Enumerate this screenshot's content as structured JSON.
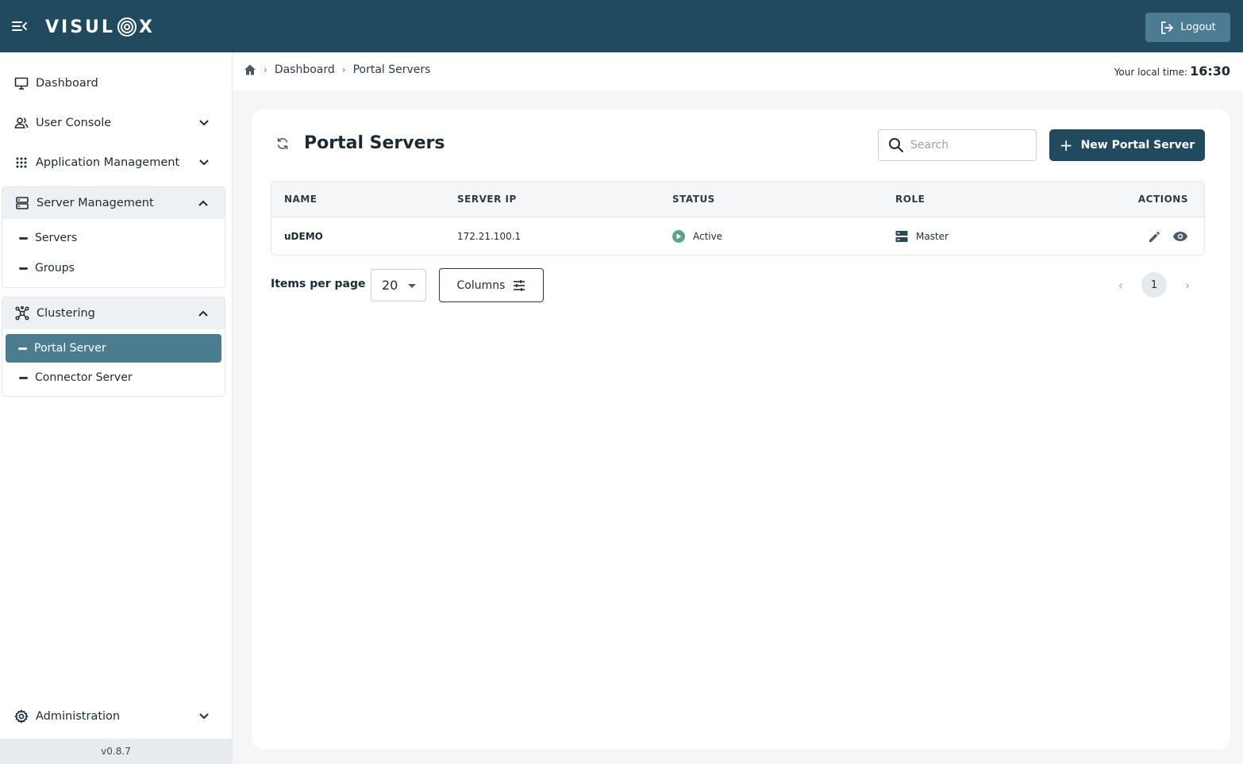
{
  "app": {
    "logo_text_left": "VISUL",
    "logo_text_right": "X"
  },
  "topbar": {
    "logout_label": "Logout"
  },
  "sidebar": {
    "dashboard": "Dashboard",
    "user_console": "User Console",
    "application_management": "Application Management",
    "server_management": {
      "label": "Server Management",
      "items": [
        "Servers",
        "Groups"
      ]
    },
    "clustering": {
      "label": "Clustering",
      "items": [
        "Portal Server",
        "Connector Server"
      ],
      "active": "Portal Server"
    },
    "administration": "Administration",
    "version": "v0.8.7"
  },
  "breadcrumb": {
    "items": [
      "Dashboard",
      "Portal Servers"
    ]
  },
  "localtime": {
    "label": "Your local time:",
    "value": "16:30"
  },
  "page": {
    "title": "Portal Servers",
    "search_placeholder": "Search",
    "new_button": "New Portal Server"
  },
  "table": {
    "columns": [
      "NAME",
      "SERVER IP",
      "STATUS",
      "ROLE",
      "ACTIONS"
    ],
    "rows": [
      {
        "name": "uDEMO",
        "server_ip": "172.21.100.1",
        "status": "Active",
        "role": "Master"
      }
    ]
  },
  "footer": {
    "items_per_page_label": "Items per page",
    "items_per_page_value": "20",
    "columns_button": "Columns",
    "current_page": "1"
  },
  "colors": {
    "topbar": "#214a5e",
    "primary_button": "#214a5e",
    "active_nav": "#4b7c8f",
    "status_active": "#5aa58b"
  }
}
